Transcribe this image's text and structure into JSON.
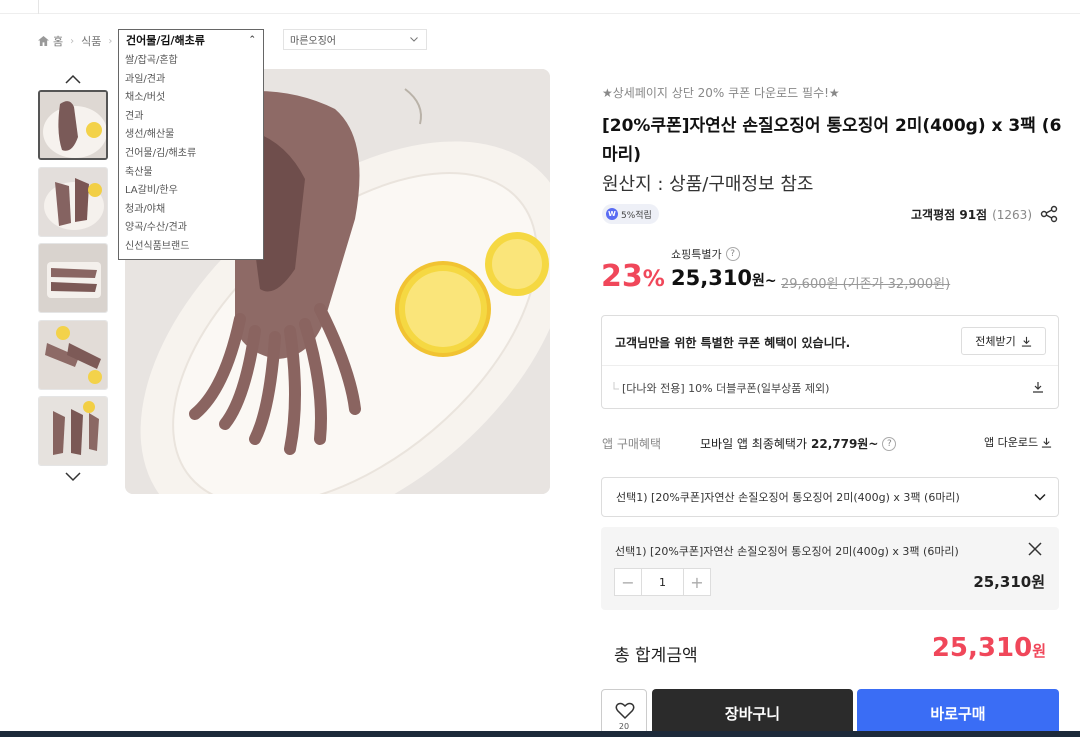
{
  "breadcrumb": {
    "home": "홈",
    "level1": "식품",
    "level2_selected": "건어물/김/해초류",
    "level2_options": [
      "쌀/잡곡/혼합",
      "과일/견과",
      "채소/버섯",
      "견과",
      "생선/해산물",
      "건어물/김/해초류",
      "축산물",
      "LA갈비/한우",
      "청과/야채",
      "양곡/수산/견과",
      "신선식품브랜드"
    ],
    "level3_selected": "마른오징어"
  },
  "product": {
    "promo": "★상세페이지 상단 20% 쿠폰 다운로드 필수!★",
    "title": "[20%쿠폰]자연산 손질오징어 통오징어 2미(400g) x 3팩 (6마리)",
    "origin": "원산지 : 상품/구매정보 참조",
    "point_badge": "5%적립",
    "badge_icon": "W",
    "rating_label": "고객평점 91점",
    "review_count": "(1263)"
  },
  "price": {
    "special_label": "쇼핑특별가",
    "discount_num": "23",
    "discount_unit": "%",
    "sale_price": "25,310",
    "sale_unit": "원~",
    "original": "29,600원 (기존가 32,900원)"
  },
  "coupon": {
    "header": "고객님만을 위한 특별한 쿠폰 혜택이 있습니다.",
    "download_all": "전체받기",
    "item": "[다나와 전용] 10% 더블쿠폰(일부상품 제외)"
  },
  "app": {
    "label": "앱 구매혜택",
    "text": "모바일 앱 최종혜택가",
    "price": "22,779원~",
    "download": "앱 다운로드"
  },
  "option": {
    "select_label": "선택1) [20%쿠폰]자연산 손질오징어 통오징어 2미(400g) x 3팩 (6마리)",
    "chosen_name": "선택1) [20%쿠폰]자연산 손질오징어 통오징어 2미(400g) x 3팩 (6마리)",
    "quantity": "1",
    "chosen_price": "25,310원"
  },
  "total": {
    "label": "총 합계금액",
    "amount": "25,310",
    "unit": "원"
  },
  "actions": {
    "like_count": "20",
    "cart": "장바구니",
    "buy": "바로구매"
  },
  "colors": {
    "accent_red": "#f0475a",
    "buy_blue": "#3a6df5",
    "cart_dark": "#2b2b2b"
  }
}
